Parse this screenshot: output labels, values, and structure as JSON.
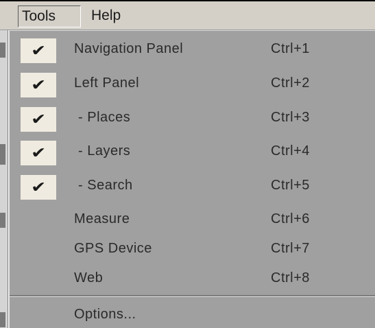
{
  "menubar": {
    "items": [
      {
        "label": "Tools"
      },
      {
        "label": "Help"
      }
    ]
  },
  "tools_menu": {
    "items": [
      {
        "label": "Navigation Panel",
        "shortcut": "Ctrl+1",
        "checked": true
      },
      {
        "label": "Left Panel",
        "shortcut": "Ctrl+2",
        "checked": true
      },
      {
        "label": " - Places",
        "shortcut": "Ctrl+3",
        "checked": true
      },
      {
        "label": " - Layers",
        "shortcut": "Ctrl+4",
        "checked": true
      },
      {
        "label": " - Search",
        "shortcut": "Ctrl+5",
        "checked": true
      },
      {
        "label": "Measure",
        "shortcut": "Ctrl+6",
        "checked": false
      },
      {
        "label": "GPS Device",
        "shortcut": "Ctrl+7",
        "checked": false
      },
      {
        "label": "Web",
        "shortcut": "Ctrl+8",
        "checked": false
      },
      {
        "label": "Options...",
        "shortcut": "",
        "checked": false
      }
    ],
    "check_glyph": "✔",
    "check_icon": "checkmark-icon"
  },
  "colors": {
    "menu_bg": "#a0a0a0",
    "menubar_bg": "#d4d0c8",
    "check_bg": "#f0ebe0"
  }
}
